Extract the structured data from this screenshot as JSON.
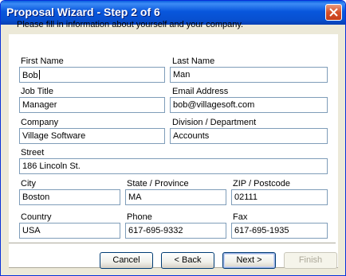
{
  "window": {
    "title": "Proposal Wizard - Step 2 of 6"
  },
  "intro": "Please fill in information about yourself and your company.",
  "fields": {
    "first_name": {
      "label": "First Name",
      "value": "Bob"
    },
    "last_name": {
      "label": "Last Name",
      "value": "Man"
    },
    "job_title": {
      "label": "Job Title",
      "value": "Manager"
    },
    "email": {
      "label": "Email Address",
      "value": "bob@villagesoft.com"
    },
    "company": {
      "label": "Company",
      "value": "Village Software"
    },
    "division": {
      "label": "Division / Department",
      "value": "Accounts"
    },
    "street": {
      "label": "Street",
      "value": "186 Lincoln St."
    },
    "city": {
      "label": "City",
      "value": "Boston"
    },
    "state": {
      "label": "State / Province",
      "value": "MA"
    },
    "zip": {
      "label": "ZIP / Postcode",
      "value": "02111"
    },
    "country": {
      "label": "Country",
      "value": "USA"
    },
    "phone": {
      "label": "Phone",
      "value": "617-695-9332"
    },
    "fax": {
      "label": "Fax",
      "value": "617-695-1935"
    }
  },
  "buttons": {
    "cancel": "Cancel",
    "back": "< Back",
    "next": "Next >",
    "finish": "Finish"
  }
}
